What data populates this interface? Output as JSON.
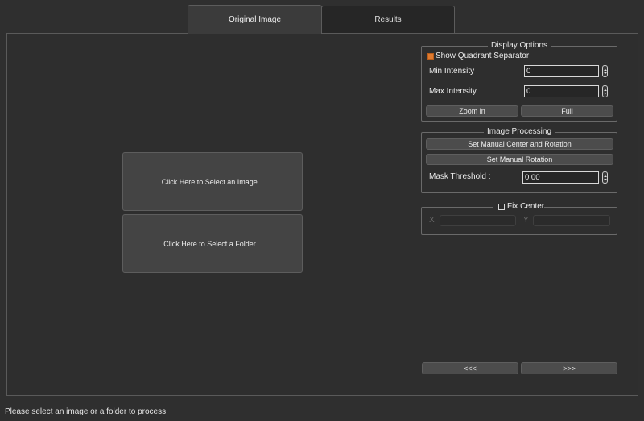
{
  "tabs": [
    {
      "label": "Original Image"
    },
    {
      "label": "Results"
    }
  ],
  "main": {
    "select_image_label": "Click Here to Select an Image...",
    "select_folder_label": "Click Here to Select a Folder..."
  },
  "display_options": {
    "title": "Display Options",
    "show_quadrant_separator": {
      "label": "Show Quadrant Separator",
      "checked": true,
      "color": "#e07a2e"
    },
    "min_intensity": {
      "label": "Min Intensity",
      "value": "0"
    },
    "max_intensity": {
      "label": "Max Intensity",
      "value": "0"
    },
    "zoom_in_label": "Zoom in",
    "full_label": "Full"
  },
  "image_processing": {
    "title": "Image Processing",
    "set_manual_center_rotation_label": "Set Manual Center and Rotation",
    "set_manual_rotation_label": "Set Manual Rotation",
    "mask_threshold": {
      "label": "Mask Threshold :",
      "value": "0.00"
    }
  },
  "fix_center": {
    "title": "Fix Center",
    "checked": false,
    "x_label": "X",
    "y_label": "Y"
  },
  "nav": {
    "prev_label": "<<<",
    "next_label": ">>>"
  },
  "status_text": "Please select an image or a folder to process"
}
